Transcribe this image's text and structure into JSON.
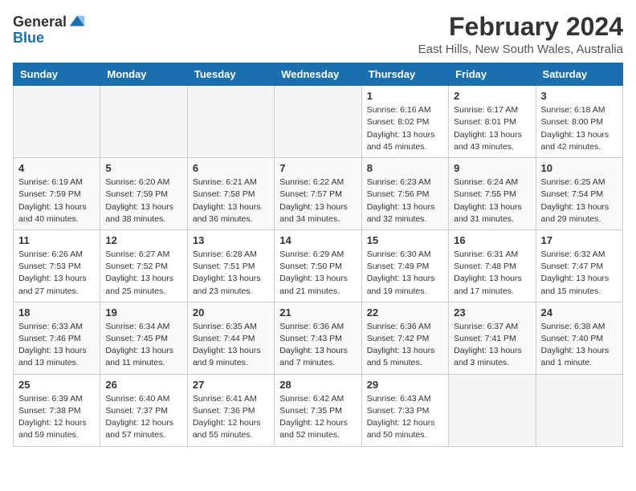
{
  "logo": {
    "general": "General",
    "blue": "Blue"
  },
  "header": {
    "title": "February 2024",
    "subtitle": "East Hills, New South Wales, Australia"
  },
  "weekdays": [
    "Sunday",
    "Monday",
    "Tuesday",
    "Wednesday",
    "Thursday",
    "Friday",
    "Saturday"
  ],
  "weeks": [
    [
      {
        "day": "",
        "info": ""
      },
      {
        "day": "",
        "info": ""
      },
      {
        "day": "",
        "info": ""
      },
      {
        "day": "",
        "info": ""
      },
      {
        "day": "1",
        "info": "Sunrise: 6:16 AM\nSunset: 8:02 PM\nDaylight: 13 hours\nand 45 minutes."
      },
      {
        "day": "2",
        "info": "Sunrise: 6:17 AM\nSunset: 8:01 PM\nDaylight: 13 hours\nand 43 minutes."
      },
      {
        "day": "3",
        "info": "Sunrise: 6:18 AM\nSunset: 8:00 PM\nDaylight: 13 hours\nand 42 minutes."
      }
    ],
    [
      {
        "day": "4",
        "info": "Sunrise: 6:19 AM\nSunset: 7:59 PM\nDaylight: 13 hours\nand 40 minutes."
      },
      {
        "day": "5",
        "info": "Sunrise: 6:20 AM\nSunset: 7:59 PM\nDaylight: 13 hours\nand 38 minutes."
      },
      {
        "day": "6",
        "info": "Sunrise: 6:21 AM\nSunset: 7:58 PM\nDaylight: 13 hours\nand 36 minutes."
      },
      {
        "day": "7",
        "info": "Sunrise: 6:22 AM\nSunset: 7:57 PM\nDaylight: 13 hours\nand 34 minutes."
      },
      {
        "day": "8",
        "info": "Sunrise: 6:23 AM\nSunset: 7:56 PM\nDaylight: 13 hours\nand 32 minutes."
      },
      {
        "day": "9",
        "info": "Sunrise: 6:24 AM\nSunset: 7:55 PM\nDaylight: 13 hours\nand 31 minutes."
      },
      {
        "day": "10",
        "info": "Sunrise: 6:25 AM\nSunset: 7:54 PM\nDaylight: 13 hours\nand 29 minutes."
      }
    ],
    [
      {
        "day": "11",
        "info": "Sunrise: 6:26 AM\nSunset: 7:53 PM\nDaylight: 13 hours\nand 27 minutes."
      },
      {
        "day": "12",
        "info": "Sunrise: 6:27 AM\nSunset: 7:52 PM\nDaylight: 13 hours\nand 25 minutes."
      },
      {
        "day": "13",
        "info": "Sunrise: 6:28 AM\nSunset: 7:51 PM\nDaylight: 13 hours\nand 23 minutes."
      },
      {
        "day": "14",
        "info": "Sunrise: 6:29 AM\nSunset: 7:50 PM\nDaylight: 13 hours\nand 21 minutes."
      },
      {
        "day": "15",
        "info": "Sunrise: 6:30 AM\nSunset: 7:49 PM\nDaylight: 13 hours\nand 19 minutes."
      },
      {
        "day": "16",
        "info": "Sunrise: 6:31 AM\nSunset: 7:48 PM\nDaylight: 13 hours\nand 17 minutes."
      },
      {
        "day": "17",
        "info": "Sunrise: 6:32 AM\nSunset: 7:47 PM\nDaylight: 13 hours\nand 15 minutes."
      }
    ],
    [
      {
        "day": "18",
        "info": "Sunrise: 6:33 AM\nSunset: 7:46 PM\nDaylight: 13 hours\nand 13 minutes."
      },
      {
        "day": "19",
        "info": "Sunrise: 6:34 AM\nSunset: 7:45 PM\nDaylight: 13 hours\nand 11 minutes."
      },
      {
        "day": "20",
        "info": "Sunrise: 6:35 AM\nSunset: 7:44 PM\nDaylight: 13 hours\nand 9 minutes."
      },
      {
        "day": "21",
        "info": "Sunrise: 6:36 AM\nSunset: 7:43 PM\nDaylight: 13 hours\nand 7 minutes."
      },
      {
        "day": "22",
        "info": "Sunrise: 6:36 AM\nSunset: 7:42 PM\nDaylight: 13 hours\nand 5 minutes."
      },
      {
        "day": "23",
        "info": "Sunrise: 6:37 AM\nSunset: 7:41 PM\nDaylight: 13 hours\nand 3 minutes."
      },
      {
        "day": "24",
        "info": "Sunrise: 6:38 AM\nSunset: 7:40 PM\nDaylight: 13 hours\nand 1 minute."
      }
    ],
    [
      {
        "day": "25",
        "info": "Sunrise: 6:39 AM\nSunset: 7:38 PM\nDaylight: 12 hours\nand 59 minutes."
      },
      {
        "day": "26",
        "info": "Sunrise: 6:40 AM\nSunset: 7:37 PM\nDaylight: 12 hours\nand 57 minutes."
      },
      {
        "day": "27",
        "info": "Sunrise: 6:41 AM\nSunset: 7:36 PM\nDaylight: 12 hours\nand 55 minutes."
      },
      {
        "day": "28",
        "info": "Sunrise: 6:42 AM\nSunset: 7:35 PM\nDaylight: 12 hours\nand 52 minutes."
      },
      {
        "day": "29",
        "info": "Sunrise: 6:43 AM\nSunset: 7:33 PM\nDaylight: 12 hours\nand 50 minutes."
      },
      {
        "day": "",
        "info": ""
      },
      {
        "day": "",
        "info": ""
      }
    ]
  ]
}
